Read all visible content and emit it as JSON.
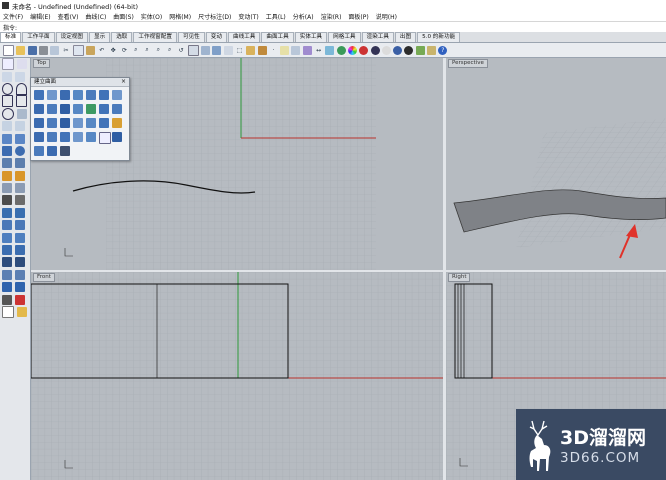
{
  "titlebar": {
    "title": "未命名 - Undefined (Undefined) (64-bit)"
  },
  "menu": [
    "文件(F)",
    "编辑(E)",
    "查看(V)",
    "曲线(C)",
    "曲面(S)",
    "实体(O)",
    "网格(M)",
    "尺寸标注(D)",
    "变动(T)",
    "工具(L)",
    "分析(A)",
    "渲染(R)",
    "面板(P)",
    "说明(H)"
  ],
  "command": {
    "label": "指令:",
    "value": ""
  },
  "tabs": [
    {
      "label": "标准",
      "active": true
    },
    {
      "label": "工作平面",
      "active": false
    },
    {
      "label": "设定视图",
      "active": false
    },
    {
      "label": "显示",
      "active": false
    },
    {
      "label": "选取",
      "active": false
    },
    {
      "label": "工作视窗配置",
      "active": false
    },
    {
      "label": "可见性",
      "active": false
    },
    {
      "label": "变动",
      "active": false
    },
    {
      "label": "曲线工具",
      "active": false
    },
    {
      "label": "曲面工具",
      "active": false
    },
    {
      "label": "实体工具",
      "active": false
    },
    {
      "label": "网格工具",
      "active": false
    },
    {
      "label": "渲染工具",
      "active": false
    },
    {
      "label": "出图",
      "active": false
    },
    {
      "label": "5.0 的新功能",
      "active": false
    }
  ],
  "viewports": {
    "top": "Top",
    "perspective": "Perspective",
    "front": "Front",
    "right": "Right"
  },
  "float_panel": {
    "title": "建立曲面"
  },
  "watermark": {
    "main": "3D溜溜网",
    "sub": "3D66.COM"
  },
  "colors": {
    "grid_bg": "#b6bbc1",
    "grid_line": "#a6abb2",
    "axis_red": "#b8302b",
    "axis_green": "#2f9a3a",
    "arrow_red": "#e0322a",
    "watermark_bg": "#3a4a63"
  }
}
